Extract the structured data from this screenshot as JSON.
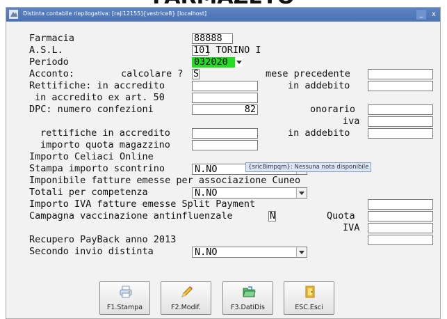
{
  "background_title": "FARMAZETO",
  "window": {
    "title": "Distinta contabile riepilogativa: [raji12155]{vestrice8} [localhost]",
    "minimize": "_",
    "close": "x"
  },
  "form": {
    "farmacia_label": "Farmacia",
    "farmacia_value": "88888",
    "asl_label": "A.S.L.",
    "asl_value": "101 TORINO I",
    "periodo_label": "Periodo",
    "periodo_value": "032020",
    "acconto_label": "Acconto:",
    "calcolare_label": "calcolare ?",
    "calcolare_value": "S",
    "mese_precedente_label": "mese precedente",
    "rettifiche_label": "Rettifiche: in accredito",
    "in_addebito_label": "in addebito",
    "accredito_art50_label": "in accredito ex art. 50",
    "dpc_label": "DPC: numero confezioni",
    "dpc_value": "82",
    "onorario_label": "onorario",
    "iva_label": "iva",
    "rettifiche_accredito_label": "rettifiche in accredito",
    "in_addebito2_label": "in addebito",
    "quota_magazzino_label": "importo quota magazzino",
    "celiaci_label": "Importo Celiaci Online",
    "stampa_scontrino_label": "Stampa importo scontrino",
    "stampa_scontrino_value": "N.NO",
    "imponibile_cuneo_label": "Imponibile fatture emesse per associazione Cuneo",
    "totali_competenza_label": "Totali per competenza",
    "totali_competenza_value": "N.NO",
    "iva_split_label": "Importo IVA fatture emesse Split Payment",
    "vaccinazione_label": "Campagna vaccinazione antinfluenzale",
    "vaccinazione_value": "N",
    "quota_label": "Quota",
    "iva2_label": "IVA",
    "payback_label": "Recupero PayBack anno 2013",
    "secondo_invio_label": "Secondo invio distinta",
    "secondo_invio_value": "N.NO"
  },
  "tooltip": "{sric8impqm}: Nessuna nota disponibile",
  "buttons": [
    {
      "label": "F1.Stampa",
      "icon": "printer-icon"
    },
    {
      "label": "F2.Modif.",
      "icon": "pencil-icon"
    },
    {
      "label": "F3.DatiDis",
      "icon": "folder-icon"
    },
    {
      "label": "ESC.Esci",
      "icon": "exit-door-icon"
    }
  ],
  "colors": {
    "titlebar": "#4a72b4",
    "highlight": "#22dd22",
    "tooltip_bg": "#dbe6f7"
  }
}
